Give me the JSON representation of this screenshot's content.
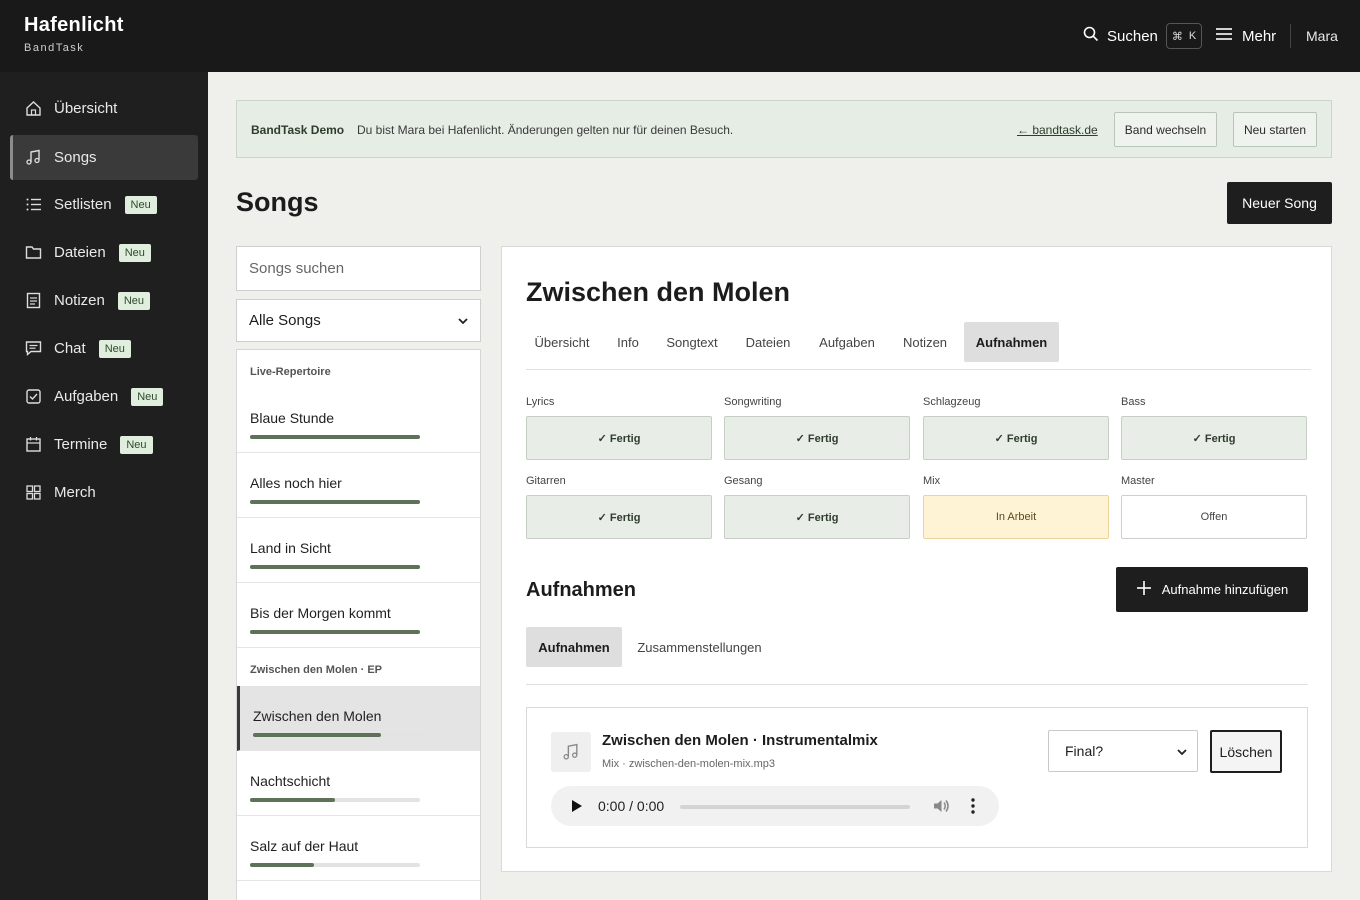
{
  "app": {
    "name": "Hafenlicht",
    "subtitle": "BandTask",
    "search_label": "Suchen",
    "search_kbd_1": "⌘",
    "search_kbd_2": "K",
    "more_label": "Mehr",
    "user": "Mara"
  },
  "sidebar": {
    "items": [
      {
        "label": "Übersicht",
        "icon": "home-icon",
        "badge": ""
      },
      {
        "label": "Songs",
        "icon": "music-note-icon",
        "badge": "",
        "active": true
      },
      {
        "label": "Setlisten",
        "icon": "list-icon",
        "badge": "Neu"
      },
      {
        "label": "Dateien",
        "icon": "folder-icon",
        "badge": "Neu"
      },
      {
        "label": "Notizen",
        "icon": "note-icon",
        "badge": "Neu"
      },
      {
        "label": "Chat",
        "icon": "chat-icon",
        "badge": "Neu"
      },
      {
        "label": "Aufgaben",
        "icon": "checkbox-icon",
        "badge": "Neu"
      },
      {
        "label": "Termine",
        "icon": "calendar-icon",
        "badge": "Neu"
      },
      {
        "label": "Merch",
        "icon": "grid-icon",
        "badge": ""
      }
    ]
  },
  "banner": {
    "title": "BandTask Demo",
    "text": "Du bist Mara bei Hafenlicht. Änderungen gelten nur für deinen Besuch.",
    "link": "← bandtask.de",
    "switch_band": "Band wechseln",
    "restart": "Neu starten"
  },
  "page": {
    "title": "Songs",
    "new_song": "Neuer Song"
  },
  "song_list": {
    "search_placeholder": "Songs suchen",
    "filter_value": "Alle Songs",
    "groups": [
      {
        "title": "Live-Repertoire"
      },
      {
        "title": "Zwischen den Molen · EP"
      }
    ],
    "songs": [
      {
        "name": "Blaue Stunde",
        "progress": 1.0
      },
      {
        "name": "Alles noch hier",
        "progress": 1.0
      },
      {
        "name": "Land in Sicht",
        "progress": 1.0
      },
      {
        "name": "Bis der Morgen kommt",
        "progress": 1.0
      },
      {
        "name": "Zwischen den Molen",
        "progress": 0.75,
        "active": true
      },
      {
        "name": "Nachtschicht",
        "progress": 0.5
      },
      {
        "name": "Salz auf der Haut",
        "progress": 0.375
      }
    ]
  },
  "detail": {
    "title": "Zwischen den Molen",
    "tabs": [
      "Übersicht",
      "Info",
      "Songtext",
      "Dateien",
      "Aufgaben",
      "Notizen",
      "Aufnahmen"
    ],
    "active_tab": "Aufnahmen",
    "stages": [
      {
        "label": "Lyrics",
        "status": "✓ Fertig",
        "state": "done"
      },
      {
        "label": "Songwriting",
        "status": "✓ Fertig",
        "state": "done"
      },
      {
        "label": "Schlagzeug",
        "status": "✓ Fertig",
        "state": "done"
      },
      {
        "label": "Bass",
        "status": "✓ Fertig",
        "state": "done"
      },
      {
        "label": "Gitarren",
        "status": "✓ Fertig",
        "state": "done"
      },
      {
        "label": "Gesang",
        "status": "✓ Fertig",
        "state": "done"
      },
      {
        "label": "Mix",
        "status": "In Arbeit",
        "state": "progress"
      },
      {
        "label": "Master",
        "status": "Offen",
        "state": "open"
      }
    ],
    "recordings_title": "Aufnahmen",
    "add_recording": "Aufnahme hinzufügen",
    "subtabs": [
      "Aufnahmen",
      "Zusammenstellungen"
    ],
    "recording": {
      "name": "Zwischen den Molen · Instrumentalmix",
      "meta": "Mix · zwischen-den-molen-mix.mp3",
      "final_select": "Final?",
      "delete": "Löschen",
      "time": "0:00 / 0:00"
    }
  },
  "colors": {
    "topbar": "#191919",
    "sidebar": "#1f1f1f",
    "accent_green": "#5d7259",
    "badge_bg": "#dfeedd",
    "progress_bg": "#fff3d6"
  }
}
